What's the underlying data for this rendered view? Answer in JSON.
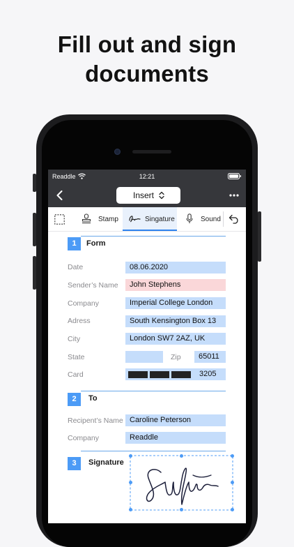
{
  "headline": {
    "line1": "Fill out and sign",
    "line2": "documents"
  },
  "status": {
    "carrier": "Readdle",
    "time": "12:21"
  },
  "nav": {
    "insert_label": "Insert"
  },
  "tools": {
    "stamp": "Stamp",
    "signature": "Singature",
    "sound": "Sound"
  },
  "sections": [
    {
      "num": "1",
      "title": "Form"
    },
    {
      "num": "2",
      "title": "To"
    },
    {
      "num": "3",
      "title": "Signature"
    }
  ],
  "form": {
    "date_label": "Date",
    "date": "08.06.2020",
    "sender_label": "Sender’s Name",
    "sender": "John Stephens",
    "company_label": "Company",
    "company": "Imperial College London",
    "address_label": "Adress",
    "address": "South Kensington Box 13",
    "city_label": "City",
    "city": "London SW7 2AZ, UK",
    "state_label": "State",
    "state": "",
    "zip_label": "Zip",
    "zip": "65011",
    "card_label": "Card",
    "card_last": "3205"
  },
  "to": {
    "recipient_label": "Recipent’s Name",
    "recipient": "Caroline Peterson",
    "company_label": "Company",
    "company": "Readdle"
  },
  "colors": {
    "accent": "#4c9bf6",
    "field": "#c5ddfb",
    "field_pink": "#fad7d9",
    "bar": "#36373b"
  }
}
